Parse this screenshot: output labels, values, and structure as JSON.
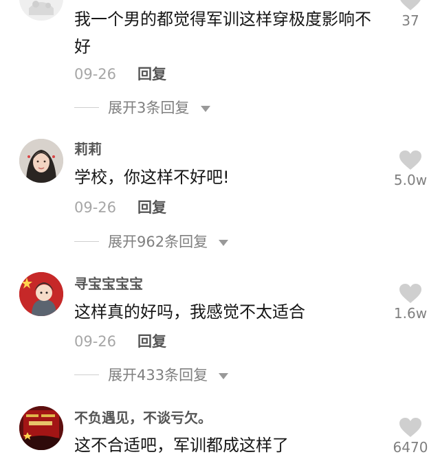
{
  "comments": [
    {
      "username": "",
      "text": "我一个男的都觉得军训这样穿极度影响不好",
      "date": "09-26",
      "reply_label": "回复",
      "expand_label": "展开3条回复",
      "likes": "37",
      "avatar": "avatar-partial"
    },
    {
      "username": "莉莉",
      "text": "学校，你这样不好吧!",
      "date": "09-26",
      "reply_label": "回复",
      "expand_label": "展开962条回复",
      "likes": "5.0w",
      "avatar": "avatar-woman"
    },
    {
      "username": "寻宝宝宝宝",
      "text": "这样真的好吗，我感觉不太适合",
      "date": "09-26",
      "reply_label": "回复",
      "expand_label": "展开433条回复",
      "likes": "1.6w",
      "avatar": "avatar-cartoon-flag"
    },
    {
      "username": "不负遇见，不谈亏欠。",
      "text": "这不合适吧，军训都成这样了",
      "likes": "6470",
      "avatar": "avatar-poster"
    }
  ],
  "colors": {
    "text_primary": "#161616",
    "text_secondary": "#a6a6a6",
    "username": "#555555",
    "heart": "#cfcfcf"
  },
  "icons": [
    "heart-icon",
    "chevron-down-icon"
  ]
}
